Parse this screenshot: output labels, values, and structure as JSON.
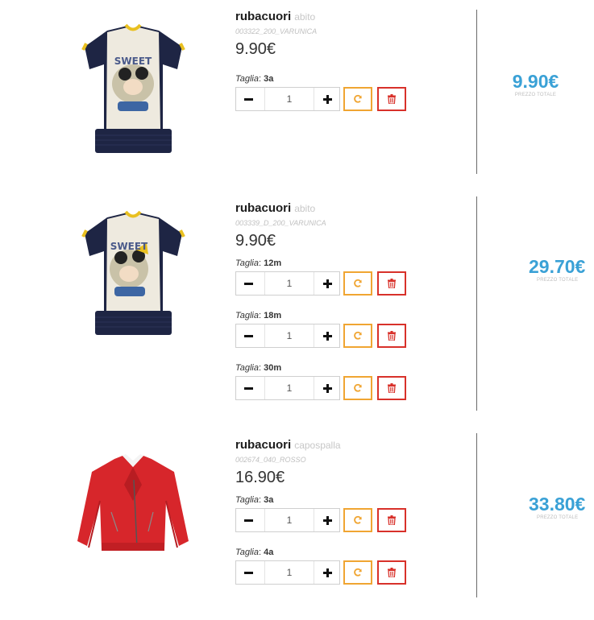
{
  "colors": {
    "accent_blue": "#3aa1d6",
    "refresh_orange": "#f0a532",
    "delete_red": "#d8312a"
  },
  "cart": {
    "items": [
      {
        "brand": "rubacuori",
        "category": "abito",
        "sku": "003322_200_VARUNICA",
        "unit_price": "9.90€",
        "image": "t-shirt-dress-mickey-navy",
        "sizes": [
          {
            "label": "Taglia",
            "value": "3a",
            "qty": "1"
          }
        ],
        "total": "9.90€",
        "total_label": "PREZZO TOTALE"
      },
      {
        "brand": "rubacuori",
        "category": "abito",
        "sku": "003339_D_200_VARUNICA",
        "unit_price": "9.90€",
        "image": "t-shirt-dress-minnie-navy",
        "sizes": [
          {
            "label": "Taglia",
            "value": "12m",
            "qty": "1"
          },
          {
            "label": "Taglia",
            "value": "18m",
            "qty": "1"
          },
          {
            "label": "Taglia",
            "value": "30m",
            "qty": "1"
          }
        ],
        "total": "29.70€",
        "total_label": "PREZZO TOTALE"
      },
      {
        "brand": "rubacuori",
        "category": "capospalla",
        "sku": "002674_040_ROSSO",
        "unit_price": "16.90€",
        "image": "red-biker-jacket",
        "sizes": [
          {
            "label": "Taglia",
            "value": "3a",
            "qty": "1"
          },
          {
            "label": "Taglia",
            "value": "4a",
            "qty": "1"
          }
        ],
        "total": "33.80€",
        "total_label": "PREZZO TOTALE"
      }
    ]
  },
  "icons": {
    "minus": "minus-icon",
    "plus": "plus-icon",
    "refresh": "refresh-icon",
    "delete": "trash-icon"
  }
}
